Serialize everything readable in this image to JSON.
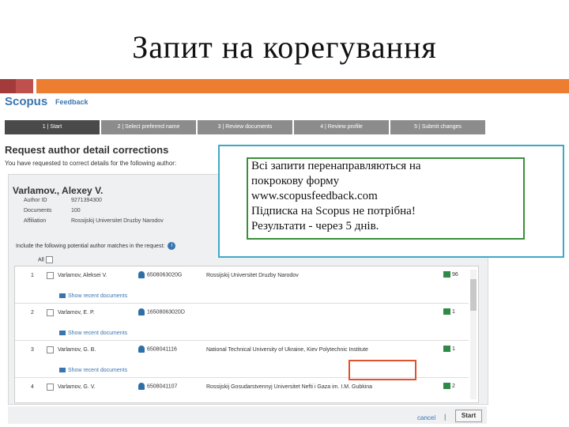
{
  "slide": {
    "title": "Запит на корегування"
  },
  "brand": {
    "logo": "Scopus",
    "sub": "Feedback"
  },
  "steps": [
    "1 | Start",
    "2 | Select preferred name",
    "3 | Review documents",
    "4 | Review profile",
    "5 | Submit changes"
  ],
  "request": {
    "title": "Request author detail corrections",
    "subtitle": "You have requested to correct details for the following author:"
  },
  "author": {
    "name": "Varlamov., Alexey V.",
    "id_label": "Author ID",
    "id_value": "9271394300",
    "docs_label": "Documents",
    "docs_value": "100",
    "aff_label": "Affiliation",
    "aff_value": "Rossijskij Universitet Druzby Narodov"
  },
  "include_text": "Include the following potential author matches in the request:",
  "all_label": "All",
  "show_recent": "Show recent documents",
  "matches": [
    {
      "num": "1",
      "name": "Varlamov, Aleksei V.",
      "id": "6508063020G",
      "aff": "Rossijskij Universitet Druzby Narodov",
      "docs": "96"
    },
    {
      "num": "2",
      "name": "Varlamov, E. P.",
      "id": "16508063020D",
      "aff": "",
      "docs": "1"
    },
    {
      "num": "3",
      "name": "Varlamov, G. B.",
      "id": "6508041116",
      "aff": "National Technical University of Ukraine, Kiev Polytechnic Institute",
      "docs": "1"
    },
    {
      "num": "4",
      "name": "Varlamov, G. V.",
      "id": "6508041107",
      "aff": "Rossijskij Gosudarstvennyj Universitet Nefti i Gaza im. I.M. Gubkina",
      "docs": "2"
    }
  ],
  "actions": {
    "cancel": "cancel",
    "separator": "|",
    "start": "Start"
  },
  "note": {
    "lines": [
      "Всі запити перенаправляються на",
      "покрокову форму",
      "www.scopusfeedback.com",
      "Підписка на Scopus не потрібна!",
      "Результати - через 5 днів."
    ]
  }
}
